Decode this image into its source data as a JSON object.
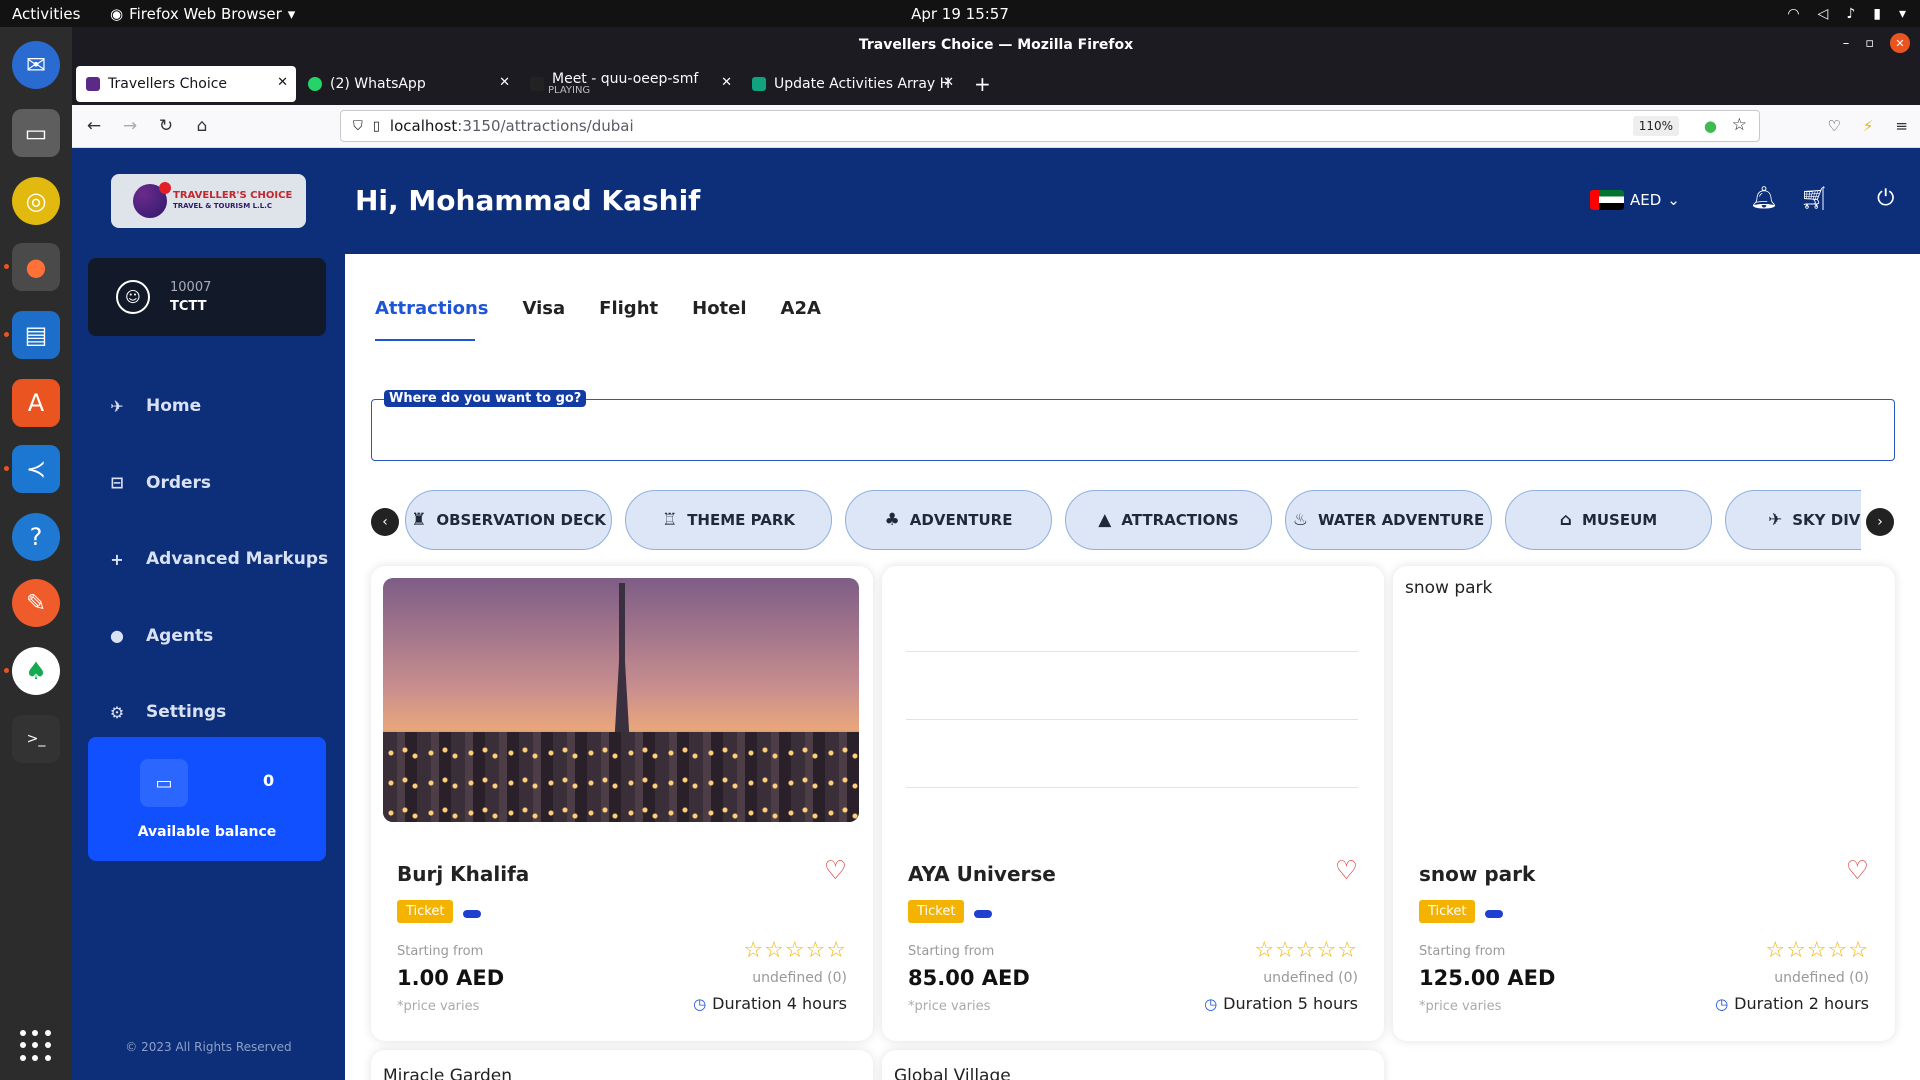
{
  "os": {
    "activities": "Activities",
    "app_menu": "Firefox Web Browser",
    "clock": "Apr 19  15:57"
  },
  "browser": {
    "window_title": "Travellers Choice — Mozilla Firefox",
    "tabs": [
      {
        "label": "Travellers Choice",
        "active": true
      },
      {
        "label": "(2) WhatsApp",
        "active": false
      },
      {
        "label": "Meet - quu-oeep-smf",
        "sub": "PLAYING",
        "active": false
      },
      {
        "label": "Update Activities Array H",
        "active": false
      }
    ],
    "url_host": "localhost",
    "url_path": ":3150/attractions/dubai",
    "zoom": "110%"
  },
  "app": {
    "logo_line1": "TRAVELLER'S CHOICE",
    "logo_line2": "TRAVEL & TOURISM L.L.C",
    "user_id": "10007",
    "user_name": "TCTT",
    "menu": [
      {
        "label": "Home",
        "icon": "rocket-icon"
      },
      {
        "label": "Orders",
        "icon": "cart-icon"
      },
      {
        "label": "Advanced Markups",
        "icon": "plus-icon"
      },
      {
        "label": "Agents",
        "icon": "user-icon"
      },
      {
        "label": "Settings",
        "icon": "gear-icon"
      }
    ],
    "balance_amount": "0",
    "balance_label": "Available balance",
    "copyright": "© 2023 All Rights Reserved",
    "greeting": "Hi, Mohammad Kashif",
    "currency": "AED",
    "colors": {
      "brand": "#0d2e79",
      "accent": "#1e55d7",
      "ticket": "#f3b300",
      "heart": "#e63a3a"
    }
  },
  "content": {
    "tabs": [
      "Attractions",
      "Visa",
      "Flight",
      "Hotel",
      "A2A"
    ],
    "active_tab": "Attractions",
    "search_label": "Where do you want to go?",
    "search_value": "",
    "categories": [
      {
        "label": "OBSERVATION DECK",
        "icon": "observation-icon"
      },
      {
        "label": "THEME PARK",
        "icon": "theme-park-icon"
      },
      {
        "label": "ADVENTURE",
        "icon": "adventure-icon"
      },
      {
        "label": "ATTRACTIONS",
        "icon": "attractions-icon"
      },
      {
        "label": "WATER ADVENTURE",
        "icon": "water-icon"
      },
      {
        "label": "MUSEUM",
        "icon": "museum-icon"
      },
      {
        "label": "SKY DIV",
        "icon": "sky-icon"
      }
    ],
    "cards": [
      {
        "name": "Burj Khalifa",
        "tag": "Ticket",
        "starting_from": "Starting from",
        "price": "1.00 AED",
        "price_note": "*price varies",
        "reviews": "undefined (0)",
        "duration": "Duration 4 hours",
        "image": "burj"
      },
      {
        "name": "AYA Universe",
        "tag": "Ticket",
        "starting_from": "Starting from",
        "price": "85.00 AED",
        "price_note": "*price varies",
        "reviews": "undefined (0)",
        "duration": "Duration 5 hours",
        "image": "code"
      },
      {
        "name": "snow park",
        "tag": "Ticket",
        "starting_from": "Starting from",
        "price": "125.00 AED",
        "price_note": "*price varies",
        "reviews": "undefined (0)",
        "duration": "Duration 2 hours",
        "image_alt": "snow park"
      }
    ],
    "more_cards": [
      "Miracle Garden",
      "Global Village"
    ]
  }
}
